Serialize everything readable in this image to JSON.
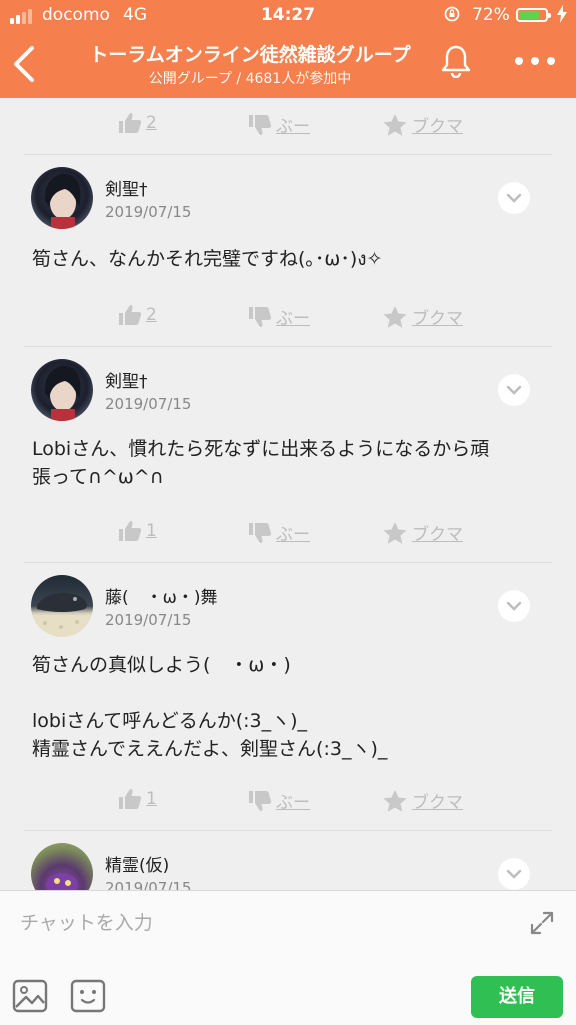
{
  "status_bar": {
    "carrier": "docomo",
    "network": "4G",
    "time": "14:27",
    "battery_percent": "72%",
    "battery_level": 0.72
  },
  "header": {
    "title": "トーラムオンライン徒然雑談グループ",
    "subtitle": "公開グループ / 4681人が参加中"
  },
  "actions_labels": {
    "dislike": "ぶー",
    "bookmark": "ブクマ"
  },
  "top_actions": {
    "likes": "2"
  },
  "posts": [
    {
      "author": "剣聖†",
      "date": "2019/07/15",
      "text": "筍さん、なんかそれ完璧ですね(｡･ω･)ง✧",
      "likes": "2"
    },
    {
      "author": "剣聖†",
      "date": "2019/07/15",
      "text": "Lobiさん、慣れたら死なずに出来るようになるから頑\n張って∩^ω^∩",
      "likes": "1"
    },
    {
      "author": "藤(　・ω・)舞",
      "date": "2019/07/15",
      "text": "筍さんの真似しよう(　・ω・)\n\nlobiさんて呼んどるんか(:3_ヽ)_\n精霊さんでええんだよ、剣聖さん(:3_ヽ)_",
      "likes": "1"
    },
    {
      "author": "精霊(仮)",
      "date": "2019/07/15"
    }
  ],
  "composer": {
    "placeholder": "チャットを入力",
    "send_label": "送信"
  },
  "colors": {
    "header": "#f5804e",
    "send": "#2fbf52",
    "background": "#efefef"
  }
}
